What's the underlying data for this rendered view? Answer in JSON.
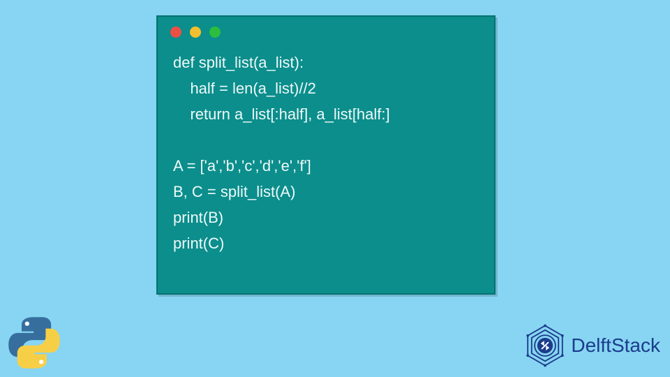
{
  "code": {
    "line1": "def split_list(a_list):",
    "line2": "    half = len(a_list)//2",
    "line3": "    return a_list[:half], a_list[half:]",
    "line4": "",
    "line5": "A = ['a','b','c','d','e','f']",
    "line6": "B, C = split_list(A)",
    "line7": "print(B)",
    "line8": "print(C)"
  },
  "brand": {
    "name": "DelftStack"
  },
  "colors": {
    "background": "#87d5f2",
    "window": "#0b8e8c",
    "brand_text": "#1b3c8c"
  }
}
